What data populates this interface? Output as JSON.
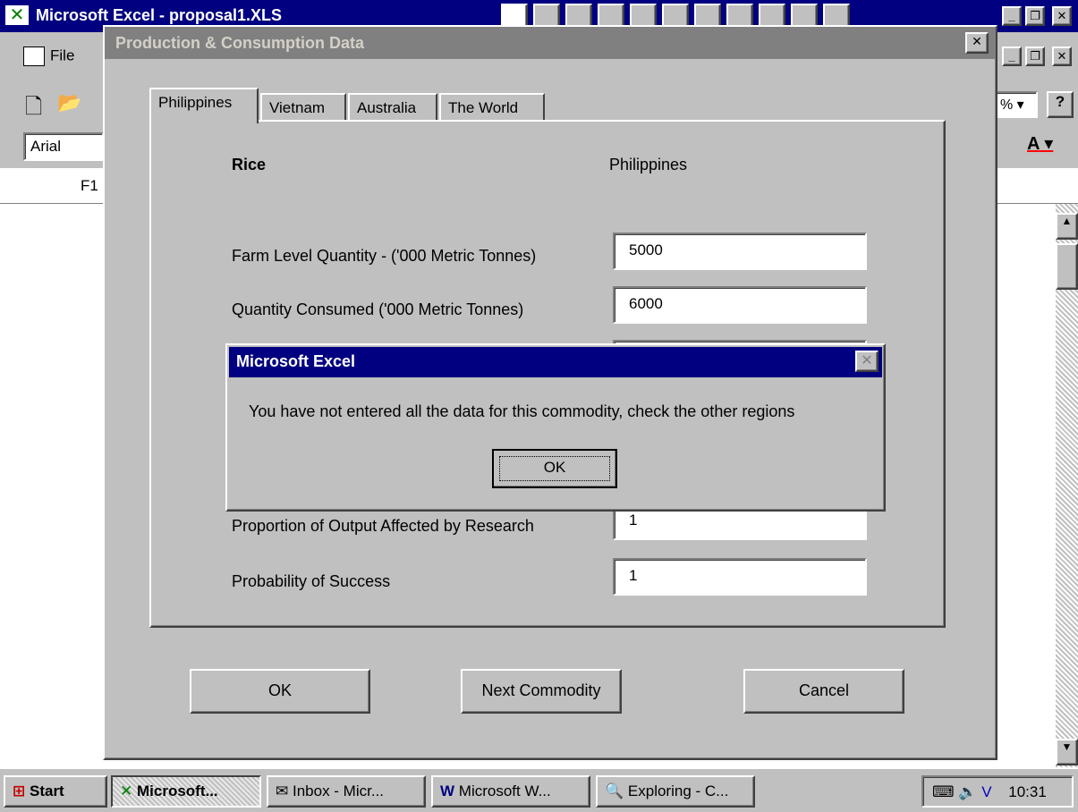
{
  "excel": {
    "title": "Microsoft Excel - proposal1.XLS",
    "menu_file": "File",
    "font_name": "Arial",
    "cell_ref": "F1",
    "zoom_fragment": "%",
    "font_color_label": "A"
  },
  "dialog": {
    "title": "Production & Consumption Data",
    "tabs": [
      {
        "label": "Philippines"
      },
      {
        "label": "Vietnam"
      },
      {
        "label": "Australia"
      },
      {
        "label": "The World"
      }
    ],
    "commodity": "Rice",
    "region": "Philippines",
    "fields": [
      {
        "label": "Farm Level Quantity - ('000 Metric Tonnes)",
        "value": "5000"
      },
      {
        "label": "Quantity Consumed ('000 Metric Tonnes)",
        "value": "6000"
      },
      {
        "label": "Proportion of Output Affected by Research",
        "value": "1"
      },
      {
        "label": "Probability of Success",
        "value": "1"
      }
    ],
    "buttons": {
      "ok": "OK",
      "next": "Next Commodity",
      "cancel": "Cancel"
    }
  },
  "msgbox": {
    "title": "Microsoft Excel",
    "message": "You have not entered all the data for this commodity, check the other regions",
    "ok": "OK"
  },
  "taskbar": {
    "start": "Start",
    "tasks": [
      {
        "label": "Microsoft..."
      },
      {
        "label": "Inbox - Micr..."
      },
      {
        "label": "Microsoft W..."
      },
      {
        "label": "Exploring - C..."
      }
    ],
    "clock": "10:31"
  },
  "colors": {
    "titlebar_active": "#000080",
    "face": "#c0c0c0"
  }
}
